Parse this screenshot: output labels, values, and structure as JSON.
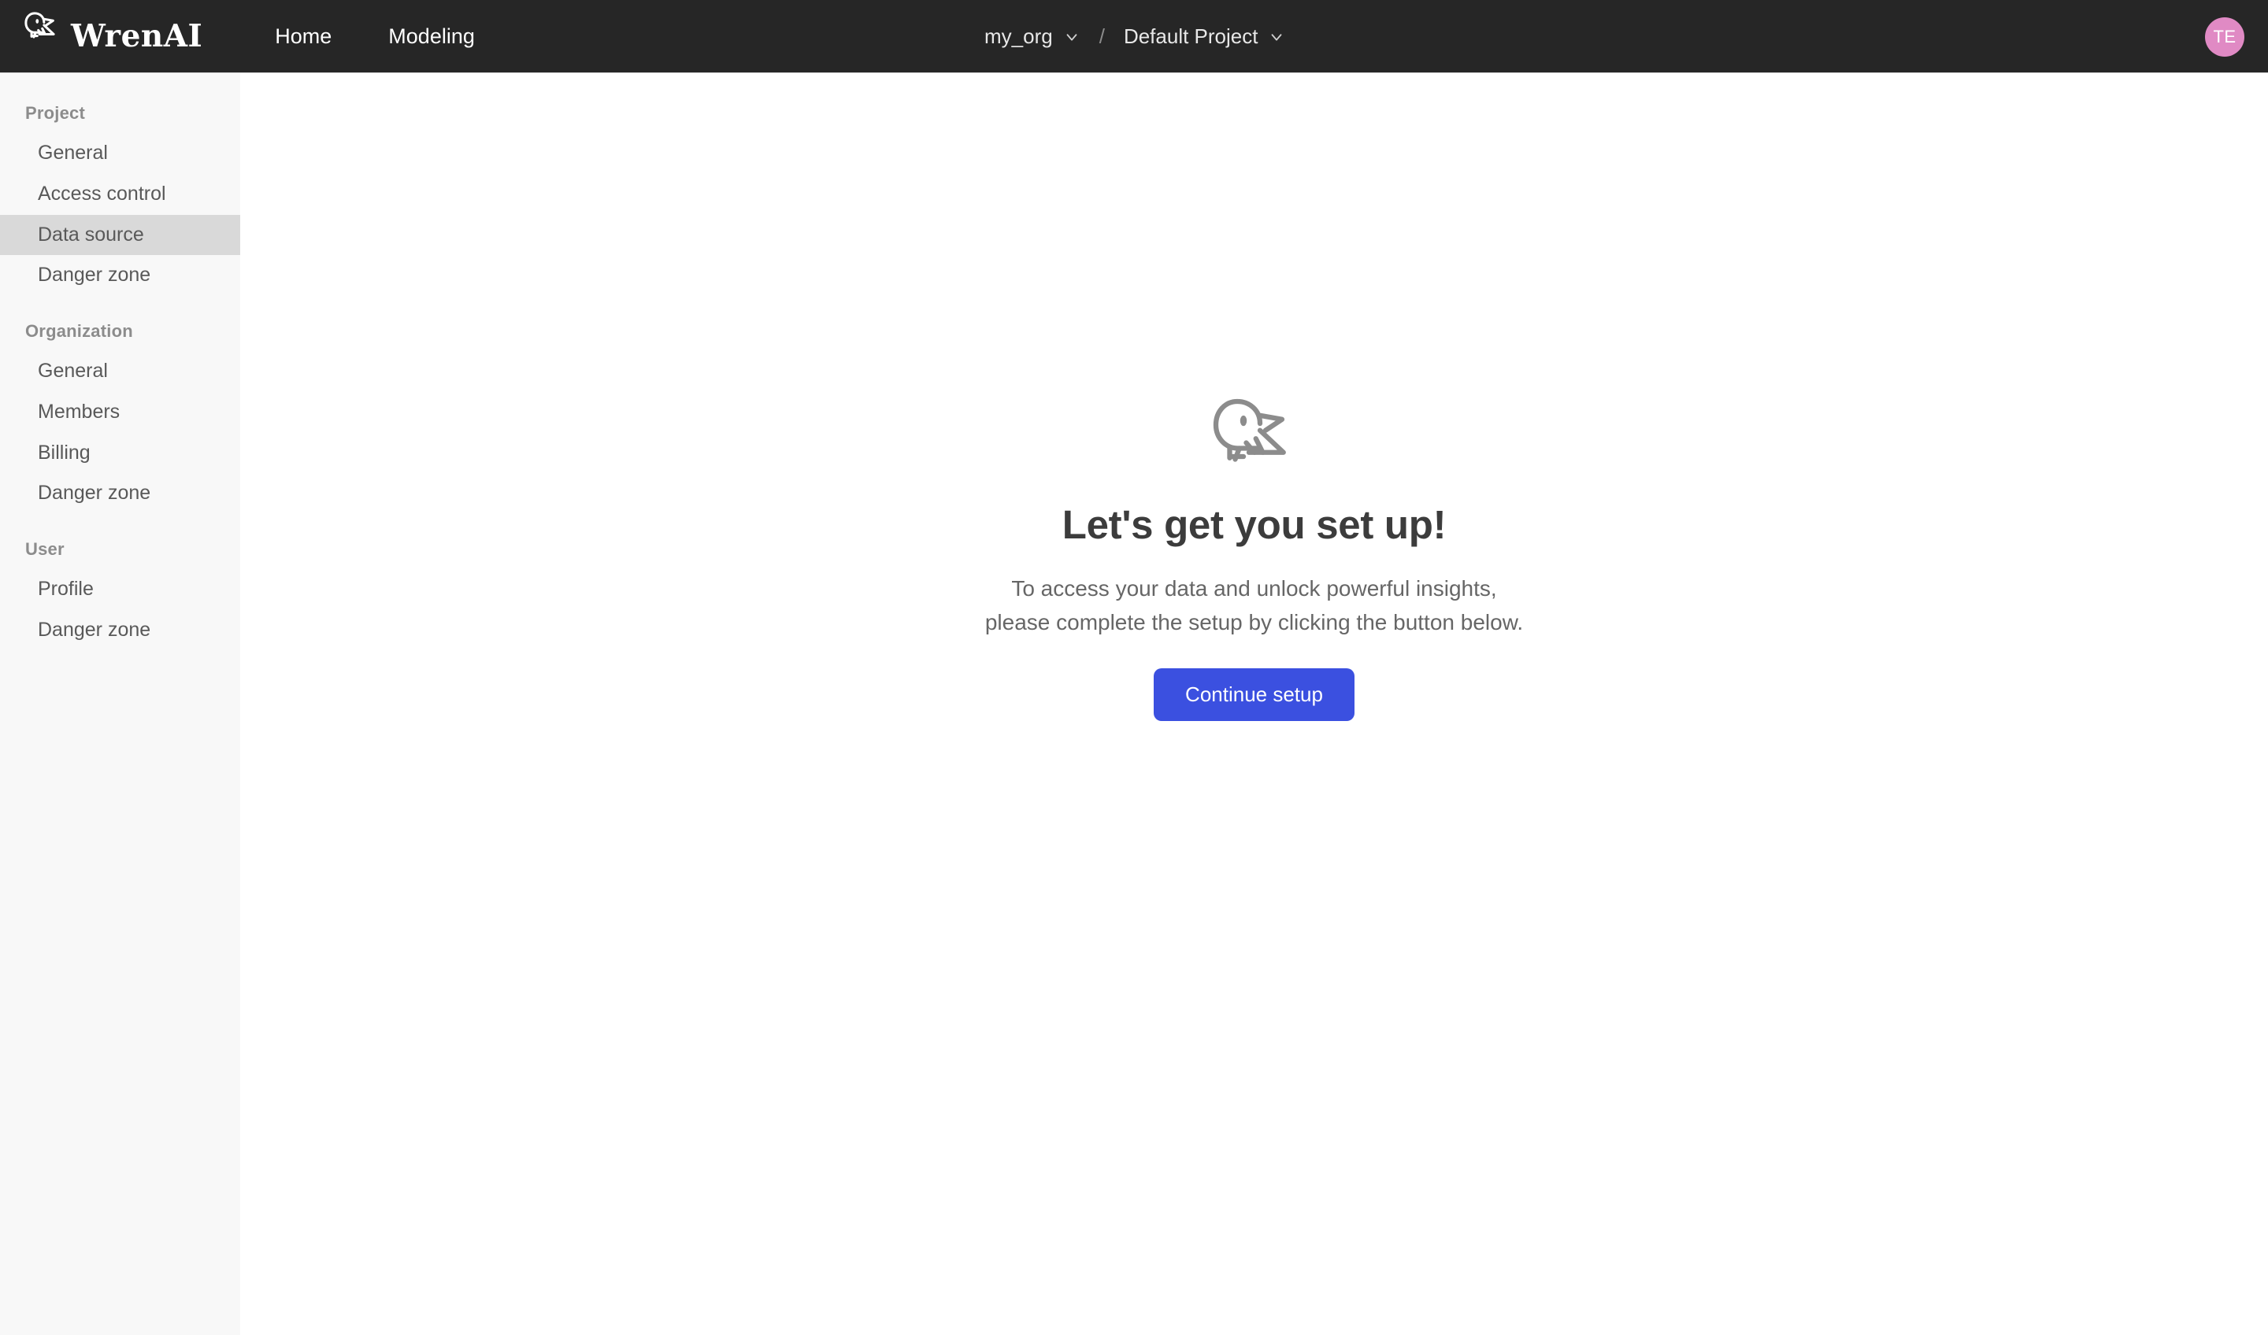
{
  "header": {
    "brand_name": "WrenAI",
    "brand_logo_icon": "wren-bird-logo-icon",
    "nav_items": [
      {
        "label": "Home",
        "name": "nav-home"
      },
      {
        "label": "Modeling",
        "name": "nav-modeling"
      }
    ],
    "context": {
      "organization": "my_org",
      "separator": "/",
      "project": "Default Project",
      "dropdown_icon": "chevron-down-icon"
    },
    "avatar": {
      "initials": "TE",
      "color": "#e08ac4"
    }
  },
  "sidebar": {
    "groups": [
      {
        "title": "Project",
        "items": [
          {
            "label": "General",
            "active": false
          },
          {
            "label": "Access control",
            "active": false
          },
          {
            "label": "Data source",
            "active": true
          },
          {
            "label": "Danger zone",
            "active": false
          }
        ]
      },
      {
        "title": "Organization",
        "items": [
          {
            "label": "General",
            "active": false
          },
          {
            "label": "Members",
            "active": false
          },
          {
            "label": "Billing",
            "active": false
          },
          {
            "label": "Danger zone",
            "active": false
          }
        ]
      },
      {
        "title": "User",
        "items": [
          {
            "label": "Profile",
            "active": false
          },
          {
            "label": "Danger zone",
            "active": false
          }
        ]
      }
    ]
  },
  "main": {
    "empty_state": {
      "illustration_icon": "wren-bird-outline-icon",
      "title": "Let's get you set up!",
      "description_line1": "To access your data and unlock powerful insights,",
      "description_line2": "please complete the setup by clicking the button below.",
      "cta_label": "Continue setup",
      "cta_color": "#3b50e0"
    }
  }
}
